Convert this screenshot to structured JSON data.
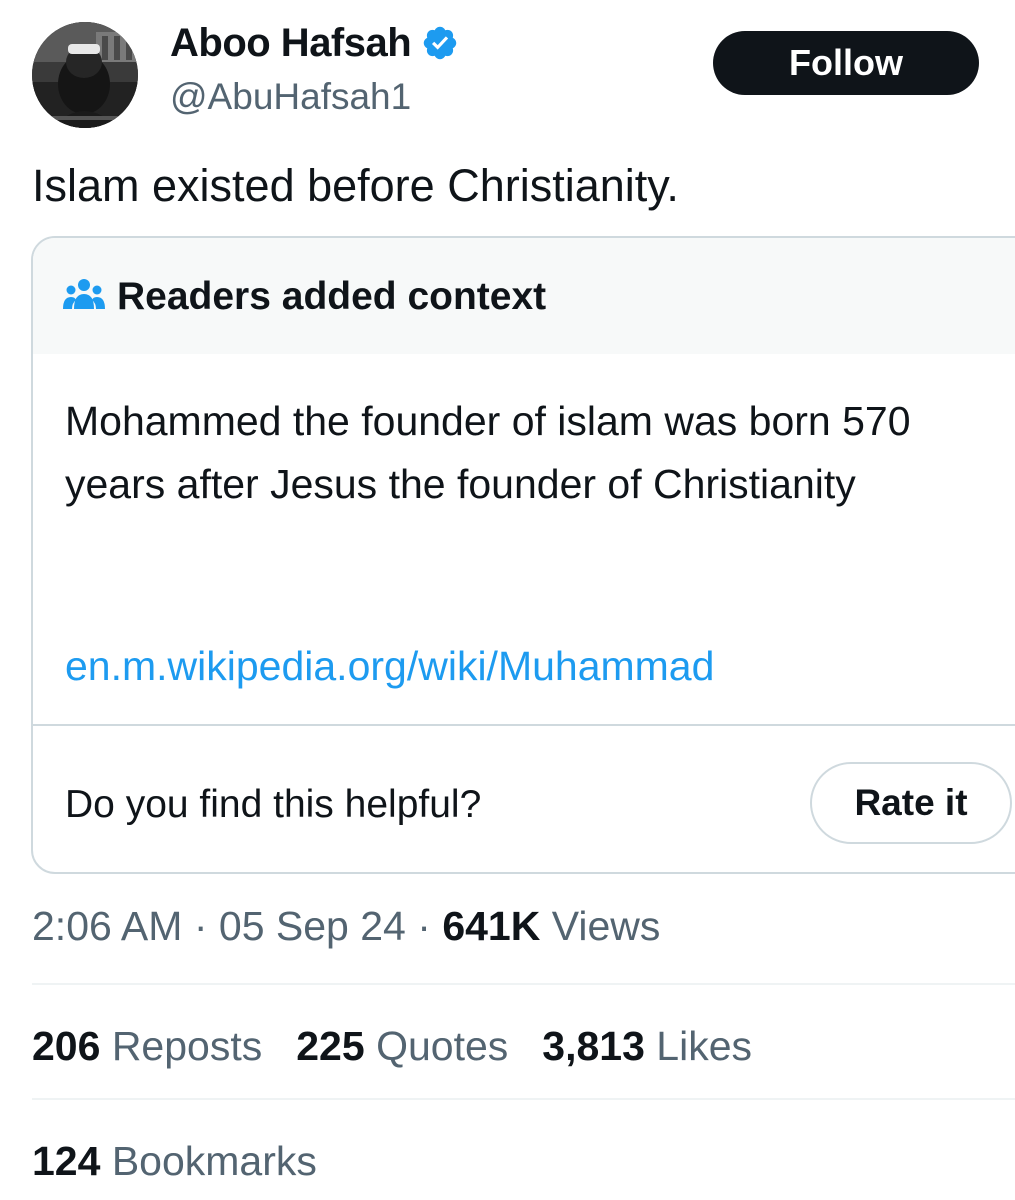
{
  "author": {
    "display_name": "Aboo Hafsah",
    "handle": "@AbuHafsah1",
    "verified": true,
    "avatar_icon": "profile-photo"
  },
  "follow_button": {
    "label": "Follow"
  },
  "tweet": {
    "text": "Islam existed before Christianity."
  },
  "community_note": {
    "title": "Readers added context",
    "icon": "readers-icon",
    "body": "Mohammed the founder of islam was born 570 years after Jesus the founder of Christianity",
    "link": "en.m.wikipedia.org/wiki/Muhammad",
    "helpful_question": "Do you find this helpful?",
    "rate_label": "Rate it"
  },
  "meta": {
    "time": "2:06 AM",
    "separator": "·",
    "date": "05 Sep 24",
    "views_count": "641K",
    "views_label": "Views"
  },
  "stats": {
    "reposts_count": "206",
    "reposts_label": "Reposts",
    "quotes_count": "225",
    "quotes_label": "Quotes",
    "likes_count": "3,813",
    "likes_label": "Likes",
    "bookmarks_count": "124",
    "bookmarks_label": "Bookmarks"
  },
  "colors": {
    "text_primary": "#0f1419",
    "text_secondary": "#536471",
    "accent_blue": "#1d9bf0",
    "border": "#cfd9de",
    "note_header_bg": "#f7f9f9"
  }
}
